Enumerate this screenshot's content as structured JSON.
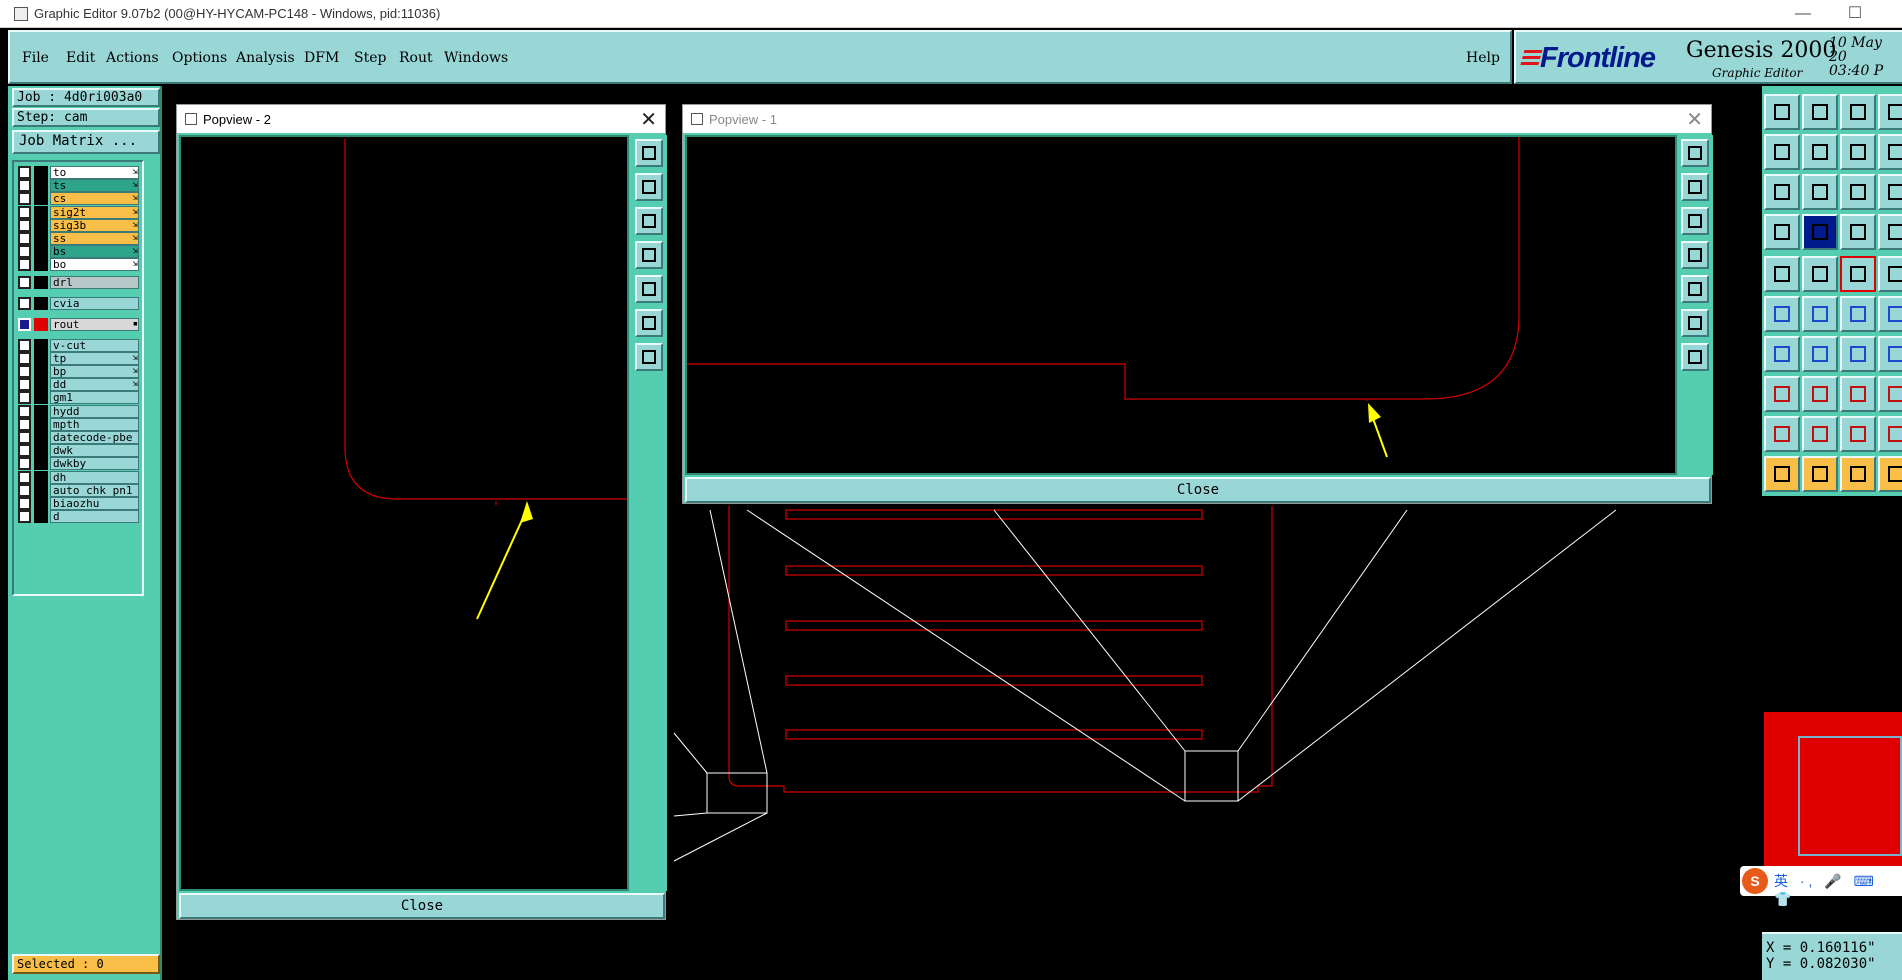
{
  "window": {
    "title": "Graphic Editor 9.07b2 (00@HY-HYCAM-PC148 - Windows, pid:11036)",
    "minimize_glyph": "—",
    "maximize_glyph": "☐",
    "close_glyph": "✕"
  },
  "menu": {
    "items": [
      "File",
      "Edit",
      "Actions",
      "Options",
      "Analysis",
      "DFM",
      "Step",
      "Rout",
      "Windows"
    ],
    "help": "Help"
  },
  "brand": {
    "logo": "Frontline",
    "product": "Genesis 2000",
    "subtitle": "Graphic Editor",
    "date_line1": "10 May 20",
    "date_line2": "03:40 P"
  },
  "job": {
    "job_label": "Job : 4d0ri003a0",
    "step_label": "Step: cam",
    "matrix_button": "Job Matrix ..."
  },
  "layers": [
    {
      "name": "to",
      "color": "#ffffff",
      "arrow": "⇲"
    },
    {
      "name": "ts",
      "color": "#2ea58a",
      "arrow": "⇲"
    },
    {
      "name": "cs",
      "color": "#f9be47",
      "arrow": "⇲"
    },
    {
      "name": "sig2t",
      "color": "#f9be47",
      "arrow": "⇲"
    },
    {
      "name": "sig3b",
      "color": "#f9be47",
      "arrow": "⇲"
    },
    {
      "name": "ss",
      "color": "#f9be47",
      "arrow": "⇲"
    },
    {
      "name": "bs",
      "color": "#2ea58a",
      "arrow": "⇲"
    },
    {
      "name": "bo",
      "color": "#ffffff",
      "arrow": "⇲"
    },
    {
      "name": "drl",
      "color": "#b8c8c8",
      "arrow": ""
    },
    {
      "name": "cvia",
      "color": "#99d7d7",
      "arrow": ""
    },
    {
      "name": "rout",
      "color": "#d8d8d8",
      "arrow": "▪"
    },
    {
      "name": "v-cut",
      "color": "#99d7d7",
      "arrow": ""
    },
    {
      "name": "tp",
      "color": "#99d7d7",
      "arrow": "⇲"
    },
    {
      "name": "bp",
      "color": "#99d7d7",
      "arrow": "⇲"
    },
    {
      "name": "dd",
      "color": "#99d7d7",
      "arrow": "⇲"
    },
    {
      "name": "gm1",
      "color": "#99d7d7",
      "arrow": ""
    },
    {
      "name": "hydd",
      "color": "#99d7d7",
      "arrow": ""
    },
    {
      "name": "mpth",
      "color": "#99d7d7",
      "arrow": ""
    },
    {
      "name": "datecode-pbe",
      "color": "#99d7d7",
      "arrow": ""
    },
    {
      "name": "dwk",
      "color": "#99d7d7",
      "arrow": ""
    },
    {
      "name": "dwkby",
      "color": "#99d7d7",
      "arrow": ""
    },
    {
      "name": "dh",
      "color": "#99d7d7",
      "arrow": ""
    },
    {
      "name": "auto_chk_pn1",
      "color": "#99d7d7",
      "arrow": ""
    },
    {
      "name": "biaozhu",
      "color": "#99d7d7",
      "arrow": ""
    },
    {
      "name": "d",
      "color": "#99d7d7",
      "arrow": ""
    }
  ],
  "status": {
    "selected": "Selected : 0",
    "x": "X = 0.160116\"",
    "y": "Y = 0.082030\""
  },
  "popview2": {
    "title": "Popview - 2",
    "close_label": "Close",
    "close_glyph": "✕"
  },
  "popview1": {
    "title": "Popview - 1",
    "close_label": "Close",
    "close_glyph": "✕"
  },
  "ime": {
    "logo": "S",
    "text": "英 ·, 🎤 ⌨ 👕"
  },
  "colors": {
    "panel_teal": "#99d7d7",
    "panel_green": "#55cdb0",
    "rout_red": "#d40000",
    "arrow_yellow": "#ffff00",
    "outline_white": "#ffffff"
  }
}
